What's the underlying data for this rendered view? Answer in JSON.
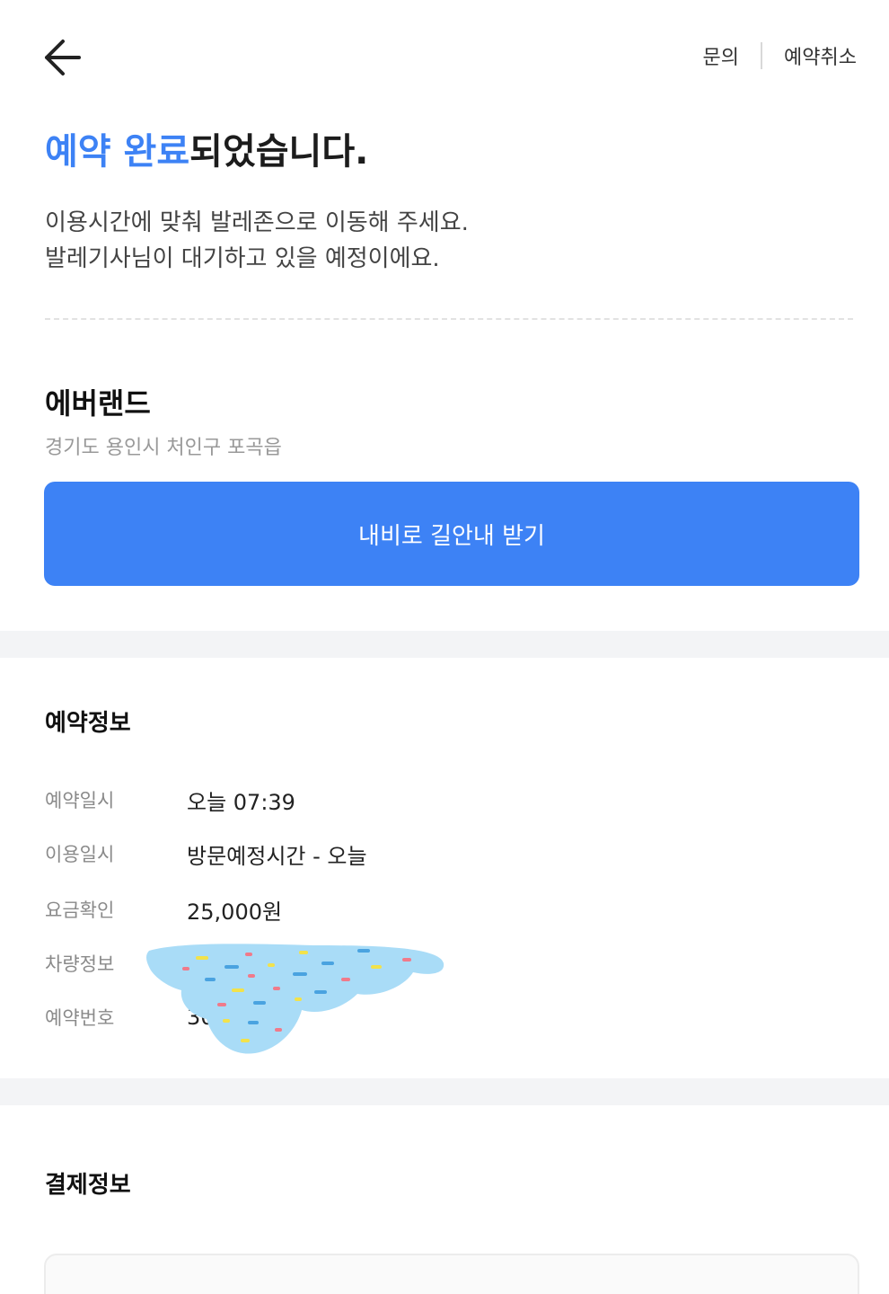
{
  "header": {
    "inquiry_label": "문의",
    "cancel_label": "예약취소"
  },
  "headline": {
    "accent": "예약 완료",
    "rest": "되었습니다."
  },
  "description": {
    "line1": "이용시간에 맞춰 발레존으로 이동해 주세요.",
    "line2": "발레기사님이 대기하고 있을 예정이에요."
  },
  "place": {
    "name": "에버랜드",
    "address": "경기도 용인시 처인구 포곡읍"
  },
  "navigation_button_label": "내비로 길안내 받기",
  "reservation": {
    "title": "예약정보",
    "rows": [
      {
        "label": "예약일시",
        "value": "오늘 07:39"
      },
      {
        "label": "이용일시",
        "value": "방문예정시간 - 오늘"
      },
      {
        "label": "요금확인",
        "value": "25,000원"
      },
      {
        "label": "차량정보",
        "value": ""
      },
      {
        "label": "예약번호",
        "value": "30"
      }
    ]
  },
  "payment": {
    "title": "결제정보"
  },
  "colors": {
    "accent": "#3d82f5",
    "band": "#f3f4f6",
    "redaction": "#a9dcf7"
  }
}
